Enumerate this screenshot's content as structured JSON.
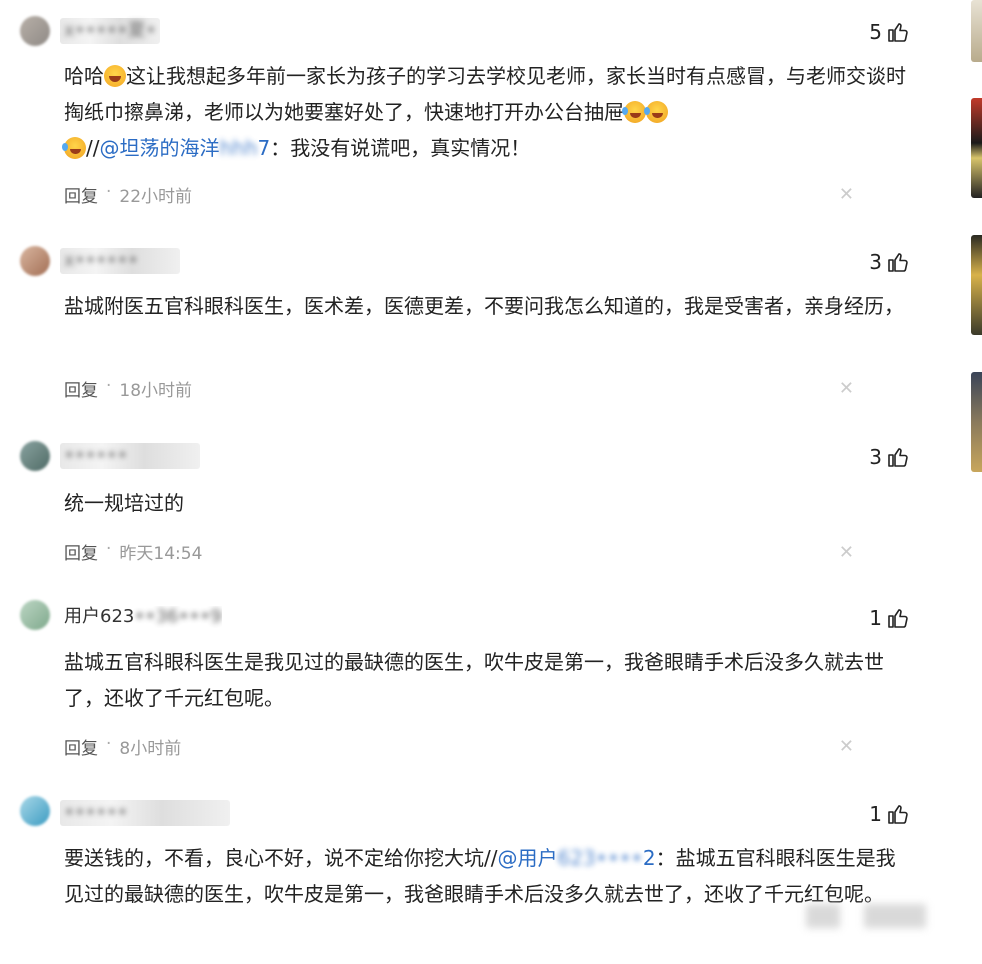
{
  "comments": [
    {
      "username": "x•••••夏•",
      "likes": "5",
      "text_before": "哈哈",
      "text_main": "这让我想起多年前一家长为孩子的学习去学校见老师，家长当时有点感冒，与老师交谈时掏纸巾擦鼻涕，老师以为她要塞好处了，快速地打开办公台抽屉",
      "mention_prefix": "//",
      "mention": "@坦荡的海洋",
      "mention_blur": "hhh",
      "mention_tail": "7",
      "text_after": "：我没有说谎吧，真实情况！",
      "reply_label": "回复",
      "time": "22小时前"
    },
    {
      "username": "x••••••",
      "likes": "3",
      "text": "盐城附医五官科眼科医生，医术差，医德更差，不要问我怎么知道的，我是受害者，亲身经历，",
      "reply_label": "回复",
      "time": "18小时前"
    },
    {
      "username": "••••••",
      "likes": "3",
      "text": "统一规培过的",
      "reply_label": "回复",
      "time": "昨天14:54"
    },
    {
      "username_visible": "用户623",
      "username_blur": "••36•••9",
      "likes": "1",
      "text": "盐城五官科眼科医生是我见过的最缺德的医生，吹牛皮是第一，我爸眼睛手术后没多久就去世了，还收了千元红包呢。",
      "reply_label": "回复",
      "time": "8小时前"
    },
    {
      "username": "••••••",
      "likes": "1",
      "text_main": "要送钱的，不看，良心不好，说不定给你挖大坑//",
      "mention": "@用户",
      "mention_blur": "623••••",
      "mention_tail": "2",
      "text_after": "：盐城五官科眼科医生是我见过的最缺德的医生，吹牛皮是第一，我爸眼睛手术后没多久就去世了，还收了千元红包呢。"
    }
  ],
  "icons": {
    "like": "thumbs-up-icon",
    "close": "close-icon",
    "emoji_laugh": "grin-emoji-icon",
    "emoji_tear": "tears-of-joy-emoji-icon"
  },
  "colors": {
    "mention": "#2b6cc4",
    "meta": "#999999"
  }
}
